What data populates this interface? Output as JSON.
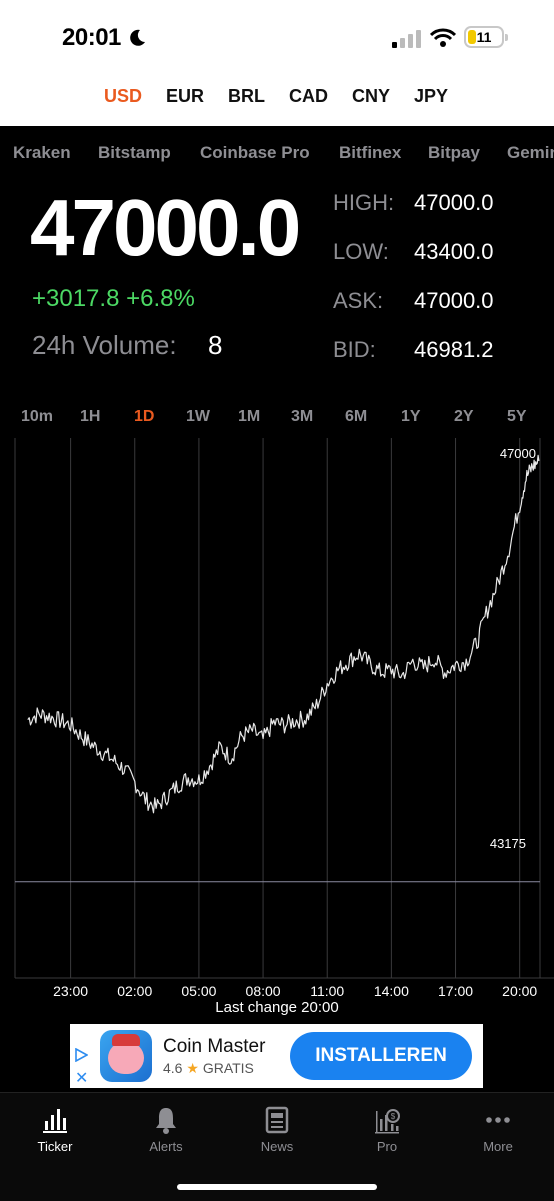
{
  "status_bar": {
    "time": "20:01",
    "battery_level": "11"
  },
  "currencies": [
    {
      "label": "USD",
      "active": true
    },
    {
      "label": "EUR"
    },
    {
      "label": "BRL"
    },
    {
      "label": "CAD"
    },
    {
      "label": "CNY"
    },
    {
      "label": "JPY"
    }
  ],
  "exchanges": [
    "Kraken",
    "Bitstamp",
    "Coinbase Pro",
    "Bitfinex",
    "Bitpay",
    "Gemini"
  ],
  "ticker": {
    "price": "47000.0",
    "change": "+3017.8 +6.8%",
    "volume_label": "24h Volume:",
    "volume_value": "8",
    "high_label": "HIGH:",
    "high_value": "47000.0",
    "low_label": "LOW:",
    "low_value": "43400.0",
    "ask_label": "ASK:",
    "ask_value": "47000.0",
    "bid_label": "BID:",
    "bid_value": "46981.2"
  },
  "ranges": [
    {
      "label": "10m"
    },
    {
      "label": "1H"
    },
    {
      "label": "1D",
      "active": true
    },
    {
      "label": "1W"
    },
    {
      "label": "1M"
    },
    {
      "label": "3M"
    },
    {
      "label": "6M"
    },
    {
      "label": "1Y"
    },
    {
      "label": "2Y"
    },
    {
      "label": "5Y"
    }
  ],
  "chart_data": {
    "type": "line",
    "x_ticks": [
      "23:00",
      "02:00",
      "05:00",
      "08:00",
      "11:00",
      "14:00",
      "17:00",
      "20:00"
    ],
    "y_ticks": [
      "47000",
      "43175"
    ],
    "reference_line": 43175,
    "ylim": [
      42300,
      47100
    ],
    "series": [
      {
        "x": [
          21.0,
          21.5,
          22.0,
          22.5,
          23.0,
          23.5,
          24.0,
          24.5,
          25.0,
          25.5,
          26.0,
          26.5,
          27.0,
          27.5,
          28.0,
          28.5,
          29.0,
          29.5,
          30.0,
          30.5,
          31.0,
          31.5,
          32.0,
          32.5,
          33.0,
          33.5,
          34.0,
          34.5,
          35.0,
          35.5,
          36.0,
          36.5,
          37.0,
          37.5,
          38.0,
          38.5,
          39.0,
          39.5,
          40.0,
          40.5,
          41.0,
          41.5,
          42.0,
          42.5,
          43.0,
          43.5,
          44.0,
          44.3,
          44.6,
          44.9
        ],
        "values": [
          44650,
          44700,
          44680,
          44640,
          44600,
          44500,
          44420,
          44350,
          44280,
          44200,
          44080,
          43920,
          43850,
          43950,
          44050,
          44120,
          44100,
          44230,
          44400,
          44300,
          44500,
          44550,
          44470,
          44620,
          44600,
          44640,
          44660,
          44780,
          44980,
          45100,
          45180,
          45250,
          45150,
          45080,
          45100,
          45050,
          45180,
          45120,
          45200,
          45080,
          45150,
          45180,
          45350,
          45650,
          45900,
          46200,
          46600,
          46850,
          46950,
          47000
        ]
      }
    ]
  },
  "last_change": "Last change 20:00",
  "ad": {
    "title": "Coin Master",
    "rating": "4.6",
    "star": "★",
    "price_label": "GRATIS",
    "button": "INSTALLEREN",
    "close": "✕"
  },
  "tabs": [
    {
      "label": "Ticker",
      "icon": "bar-chart-icon",
      "active": true
    },
    {
      "label": "Alerts",
      "icon": "bell-icon"
    },
    {
      "label": "News",
      "icon": "newspaper-icon"
    },
    {
      "label": "Pro",
      "icon": "pro-chart-icon"
    },
    {
      "label": "More",
      "icon": "more-dots-icon"
    }
  ]
}
